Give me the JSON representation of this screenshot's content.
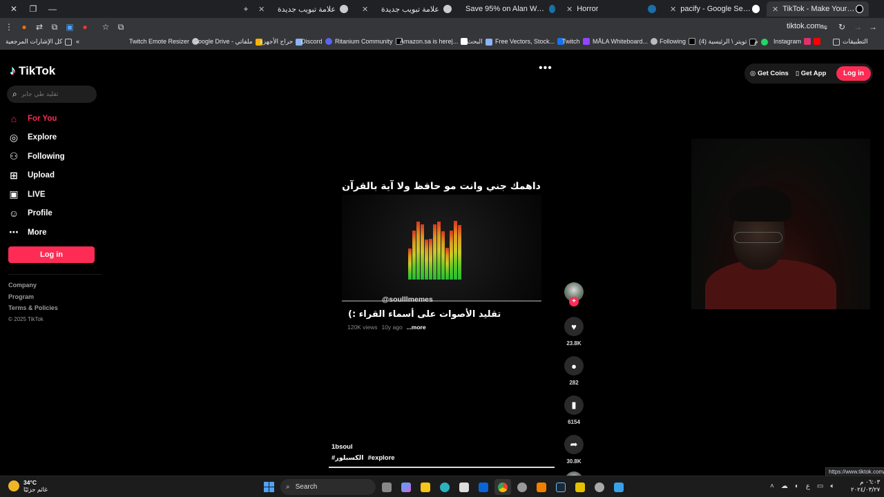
{
  "browser": {
    "tabs": [
      {
        "label": "علامة تبويب جديدة",
        "icon": "steam-icon"
      },
      {
        "label": "علامة تبويب جديدة",
        "icon": "steam-icon"
      },
      {
        "label": "Save 95% on Alan Wake on Ste",
        "icon": "steam-icon"
      },
      {
        "label": "Horror",
        "icon": "steam-icon"
      },
      {
        "label": "pacify - Google Search",
        "icon": "google-icon"
      },
      {
        "label": "TikTok - Make Your Day",
        "icon": "tiktok-icon"
      }
    ],
    "new_tab": "+",
    "url": "tiktok.com",
    "bookmarks": [
      "كل الإشارات المرجعية",
      "Twitch Emote Resizer",
      "Google Drive - ملفاتي",
      "حراج الأجهزة",
      "Discord",
      "Ritanium Community",
      "Amazon.sa is here|...",
      "البحث",
      "Free Vectors, Stock...",
      "Twitch",
      "MÅLA Whiteboard...",
      "Following",
      "(4) تويتر \\ الرئيسية",
      "م",
      "Instagram",
      "التطبيقات"
    ]
  },
  "tiktok": {
    "brand": "TikTok",
    "search_placeholder": "تقليد طي جابر",
    "nav": [
      {
        "label": "For You",
        "icon": "home-icon",
        "active": true
      },
      {
        "label": "Explore",
        "icon": "compass-icon"
      },
      {
        "label": "Following",
        "icon": "following-icon"
      },
      {
        "label": "Upload",
        "icon": "upload-icon"
      },
      {
        "label": "LIVE",
        "icon": "live-icon"
      },
      {
        "label": "Profile",
        "icon": "profile-icon"
      },
      {
        "label": "More",
        "icon": "more-icon"
      }
    ],
    "login_label": "Log in",
    "footer": [
      "Company",
      "Program",
      "Terms & Policies",
      "© 2025 TikTok"
    ],
    "top_right": {
      "coins": "Get Coins",
      "app": "Get App",
      "login": "Log in"
    },
    "video": {
      "overlay_text": "داهمك جني وانت مو حافظ ولا آية بالقرآن :",
      "handle": "@soulllmemes",
      "title": "تقليد الأصوات على أسماء القراء :)",
      "views": "120K views",
      "age": "10y ago",
      "more": "...more",
      "author": "1bsoul",
      "tags": [
        "#الكسبلور",
        "#explore"
      ],
      "progress": 1.0
    },
    "actions": {
      "likes": "23.8K",
      "comments": "282",
      "saves": "6154",
      "shares": "30.8K"
    }
  },
  "taskbar": {
    "temperature": "34°C",
    "weather_desc": "غائم جزئيًا",
    "search": "Search",
    "clock_time": "٠٦:٠٣ م",
    "clock_date": "٢٠٢٤/٠٣/٢٧",
    "lang": "ع",
    "status_url": "https://www.tiktok.com/"
  },
  "colors": {
    "accent": "#fe2c55",
    "page_bg": "#000000",
    "chrome_bg": "#35363a"
  }
}
